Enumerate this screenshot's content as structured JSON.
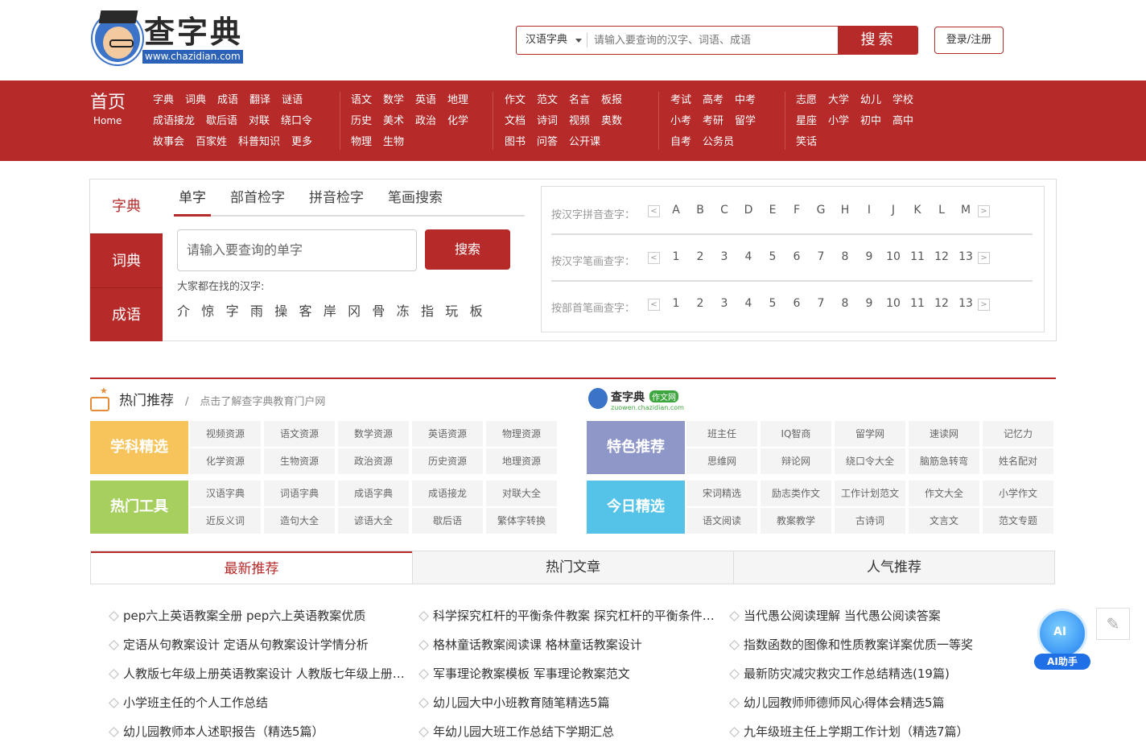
{
  "header": {
    "logo_text": "查字典",
    "logo_url": "www.chazidian.com",
    "search_select": "汉语字典",
    "search_placeholder": "请输入要查询的汉字、词语、成语",
    "search_button": "搜索",
    "login": "登录/注册"
  },
  "nav": {
    "home_cn": "首页",
    "home_en": "Home",
    "groups": [
      [
        [
          "字典",
          "词典",
          "成语",
          "翻译",
          "谜语"
        ],
        [
          "成语接龙",
          "歇后语",
          "对联",
          "绕口令"
        ],
        [
          "故事会",
          "百家姓",
          "科普知识",
          "更多"
        ]
      ],
      [
        [
          "语文",
          "数学",
          "英语",
          "地理"
        ],
        [
          "历史",
          "美术",
          "政治",
          "化学"
        ],
        [
          "物理",
          "生物"
        ]
      ],
      [
        [
          "作文",
          "范文",
          "名言",
          "板报"
        ],
        [
          "文档",
          "诗词",
          "视频",
          "奥数"
        ],
        [
          "图书",
          "问答",
          "公开课"
        ]
      ],
      [
        [
          "考试",
          "高考",
          "中考"
        ],
        [
          "小考",
          "考研",
          "留学"
        ],
        [
          "自考",
          "公务员"
        ]
      ],
      [
        [
          "志愿",
          "大学",
          "幼儿",
          "学校"
        ],
        [
          "星座",
          "小学",
          "初中",
          "高中"
        ],
        [
          "笑话"
        ]
      ]
    ]
  },
  "dict": {
    "side": [
      "字典",
      "词典",
      "成语"
    ],
    "tabs": [
      "单字",
      "部首检字",
      "拼音检字",
      "笔画搜索"
    ],
    "input_placeholder": "请输入要查询的单字",
    "search_button": "搜索",
    "hot_label": "大家都在找的汉字:",
    "hot_chars": [
      "介",
      "惊",
      "字",
      "雨",
      "操",
      "客",
      "岸",
      "冈",
      "骨",
      "冻",
      "指",
      "玩",
      "板"
    ],
    "index_rows": [
      {
        "label": "按汉字拼音查字：",
        "items": [
          "A",
          "B",
          "C",
          "D",
          "E",
          "F",
          "G",
          "H",
          "I",
          "J",
          "K",
          "L",
          "M"
        ]
      },
      {
        "label": "按汉字笔画查字：",
        "items": [
          "1",
          "2",
          "3",
          "4",
          "5",
          "6",
          "7",
          "8",
          "9",
          "10",
          "11",
          "12",
          "13"
        ]
      },
      {
        "label": "按部首笔画查字：",
        "items": [
          "1",
          "2",
          "3",
          "4",
          "5",
          "6",
          "7",
          "8",
          "9",
          "10",
          "11",
          "12",
          "13"
        ]
      }
    ],
    "arrow_left": "<",
    "arrow_right": ">"
  },
  "hot": {
    "title": "热门推荐",
    "slash": "/",
    "subtitle": "点击了解查字典教育门户网",
    "zuowen_logo": "查字典",
    "zuowen_badge": "作文网",
    "zuowen_url": "zuowen.chazidian.com",
    "blocks": [
      {
        "tag": "学科精选",
        "color": "#f6c45a",
        "items": [
          "视频资源",
          "语文资源",
          "数学资源",
          "英语资源",
          "物理资源",
          "化学资源",
          "生物资源",
          "政治资源",
          "历史资源",
          "地理资源"
        ]
      },
      {
        "tag": "特色推荐",
        "color": "#8f97c9",
        "items": [
          "班主任",
          "IQ智商",
          "留学网",
          "速读网",
          "记忆力",
          "思维网",
          "辩论网",
          "绕口令大全",
          "脑筋急转弯",
          "姓名配对"
        ]
      },
      {
        "tag": "热门工具",
        "color": "#a6cf5e",
        "items": [
          "汉语字典",
          "词语字典",
          "成语字典",
          "成语接龙",
          "对联大全",
          "近反义词",
          "造句大全",
          "谚语大全",
          "歇后语",
          "繁体字转换"
        ]
      },
      {
        "tag": "今日精选",
        "color": "#55c3e8",
        "items": [
          "宋词精选",
          "励志类作文",
          "工作计划范文",
          "作文大全",
          "小学作文",
          "语文阅读",
          "教案教学",
          "古诗词",
          "文言文",
          "范文专题"
        ]
      }
    ]
  },
  "bottom": {
    "tabs": [
      "最新推荐",
      "热门文章",
      "人气推荐"
    ],
    "columns": [
      [
        "pep六上英语教案全册 pep六上英语教案优质",
        "定语从句教案设计 定语从句教案设计学情分析",
        "人教版七年级上册英语教案设计 人教版七年级上册英语教案",
        "小学班主任的个人工作总结",
        "幼儿园教师本人述职报告（精选5篇）"
      ],
      [
        "科学探究杠杆的平衡条件教案 探究杠杆的平衡条件教案",
        "格林童话教案阅读课 格林童话教案设计",
        "军事理论教案模板 军事理论教案范文",
        "幼儿园大中小班教育随笔精选5篇",
        "年幼儿园大班工作总结下学期汇总"
      ],
      [
        "当代愚公阅读理解 当代愚公阅读答案",
        "指数函数的图像和性质教案详案优质一等奖",
        "最新防灾减灾救灾工作总结精选(19篇)",
        "幼儿园教师师德师风心得体会精选5篇",
        "九年级班主任上学期工作计划（精选7篇）"
      ]
    ]
  },
  "float": {
    "ai_icon": "AI",
    "ai_label": "AI助手",
    "pen_icon": "✎"
  }
}
